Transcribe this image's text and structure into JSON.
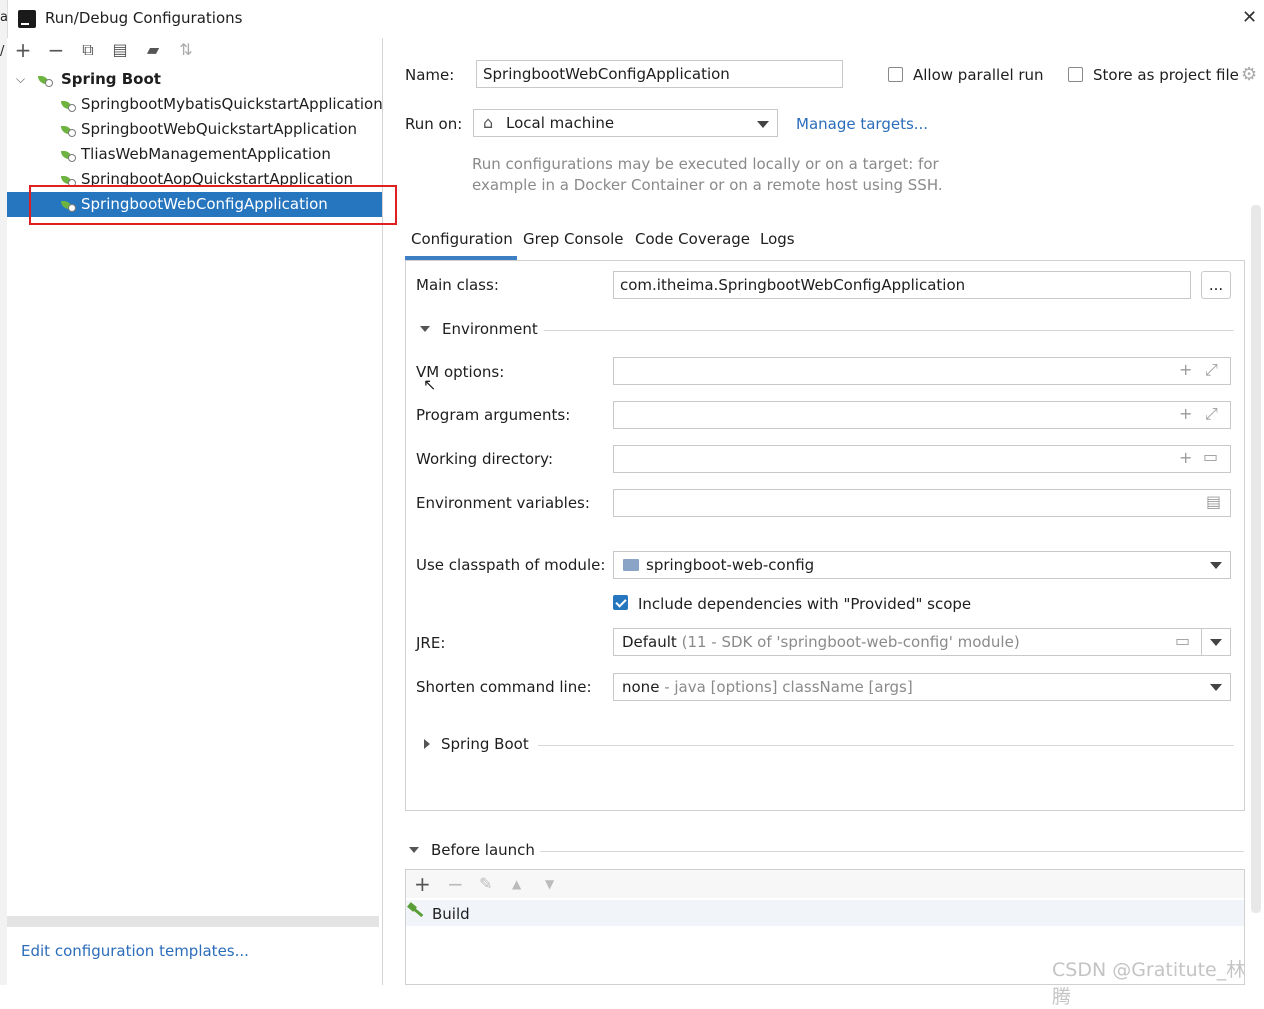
{
  "window": {
    "title": "Run/Debug Configurations",
    "close_glyph": "✕"
  },
  "left_edge": {
    "chars": [
      "a",
      "/"
    ]
  },
  "toolbar": {
    "add": "+",
    "remove": "−",
    "copy": "⧉",
    "save": "▤",
    "folder": "▰",
    "sort": "⇅"
  },
  "tree": {
    "group_label": "Spring Boot",
    "items": [
      "SpringbootMybatisQuickstartApplication",
      "SpringbootWebQuickstartApplication",
      "TliasWebManagementApplication",
      "SpringbootAopQuickstartApplication",
      "SpringbootWebConfigApplication"
    ],
    "selected_index": 4
  },
  "left_footer": {
    "edit_templates": "Edit configuration templates..."
  },
  "form": {
    "name_label": "Name:",
    "name_value": "SpringbootWebConfigApplication",
    "allow_parallel_label": "Allow parallel run",
    "allow_parallel_checked": false,
    "store_project_label": "Store as project file",
    "store_project_checked": false,
    "run_on_label": "Run on:",
    "run_on_value": "Local machine",
    "manage_targets": "Manage targets...",
    "hint_line1": "Run configurations may be executed locally or on a target: for",
    "hint_line2": "example in a Docker Container or on a remote host using SSH."
  },
  "tabs": [
    "Configuration",
    "Grep Console",
    "Code Coverage",
    "Logs"
  ],
  "config": {
    "main_class_label": "Main class:",
    "main_class_value": "com.itheima.SpringbootWebConfigApplication",
    "browse_label": "...",
    "environment_label": "Environment",
    "vm_options_label": "VM options:",
    "program_args_label": "Program arguments:",
    "working_dir_label": "Working directory:",
    "env_vars_label": "Environment variables:",
    "classpath_label": "Use classpath of module:",
    "classpath_value": "springboot-web-config",
    "include_deps_label": "Include dependencies with \"Provided\" scope",
    "include_deps_checked": true,
    "jre_label": "JRE:",
    "jre_value": "Default",
    "jre_detail": "(11 - SDK of 'springboot-web-config' module)",
    "shorten_label": "Shorten command line:",
    "shorten_value": "none",
    "shorten_detail": "- java [options] className [args]",
    "spring_boot_section": "Spring Boot"
  },
  "before_launch": {
    "label": "Before launch",
    "tools": {
      "add": "+",
      "remove": "−",
      "edit": "✎",
      "up": "▲",
      "down": "▼"
    },
    "items": [
      "Build"
    ]
  },
  "watermark": "CSDN @Gratitute_林腾",
  "colors": {
    "selection": "#2675bf",
    "link": "#2b6dbb",
    "highlight_box": "#e02020"
  }
}
